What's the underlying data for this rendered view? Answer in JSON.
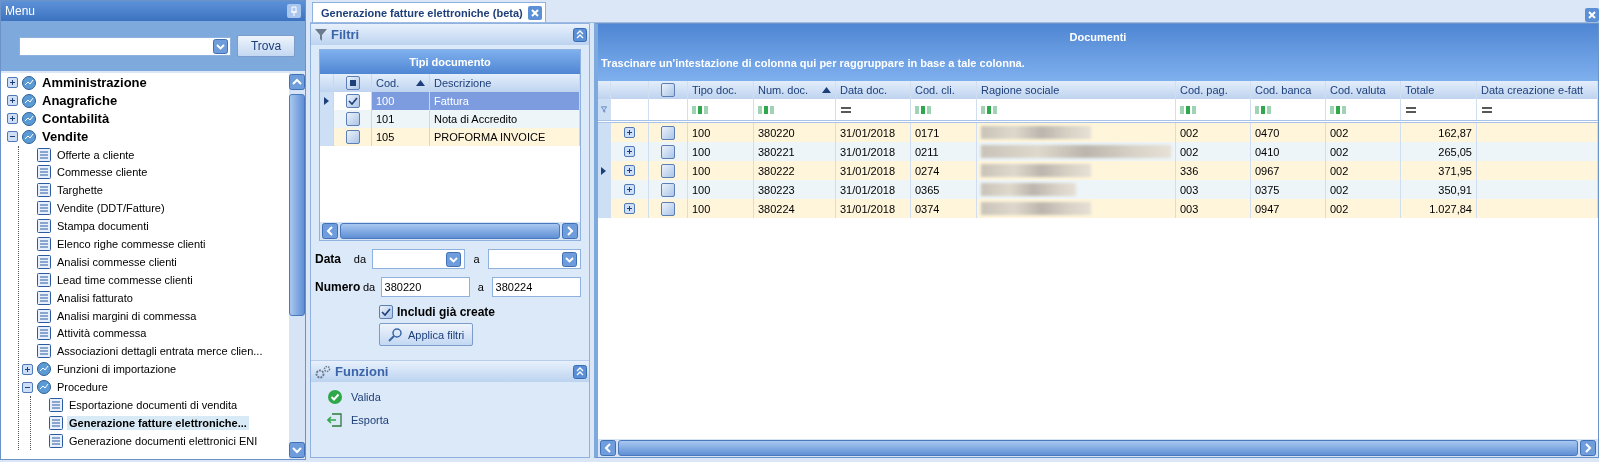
{
  "menu": {
    "title": "Menu",
    "search_button": "Trova",
    "tree": [
      {
        "label": "Amministrazione",
        "expanded": false,
        "selected": false
      },
      {
        "label": "Anagrafiche",
        "expanded": false,
        "selected": false
      },
      {
        "label": "Contabilità",
        "expanded": false,
        "selected": false
      },
      {
        "label": "Vendite",
        "expanded": true,
        "selected": false,
        "children": [
          {
            "label": "Offerte a cliente",
            "selected": false
          },
          {
            "label": "Commesse cliente",
            "selected": false
          },
          {
            "label": "Targhette",
            "selected": false
          },
          {
            "label": "Vendite (DDT/Fatture)",
            "selected": false
          },
          {
            "label": "Stampa documenti",
            "selected": false
          },
          {
            "label": "Elenco righe commesse clienti",
            "selected": false
          },
          {
            "label": "Analisi commesse clienti",
            "selected": false
          },
          {
            "label": "Lead time commesse clienti",
            "selected": false
          },
          {
            "label": "Analisi fatturato",
            "selected": false
          },
          {
            "label": "Analisi margini di commessa",
            "selected": false
          },
          {
            "label": "Attività commessa",
            "selected": false
          },
          {
            "label": "Associazioni dettagli entrata merce clien...",
            "selected": false
          },
          {
            "label": "Funzioni di importazione",
            "expanded": false,
            "selected": false
          },
          {
            "label": "Procedure",
            "expanded": true,
            "selected": false,
            "children": [
              {
                "label": "Esportazione documenti di vendita",
                "selected": false
              },
              {
                "label": "Generazione fatture elettroniche...",
                "selected": true
              },
              {
                "label": "Generazione documenti elettronici ENI",
                "selected": false
              }
            ]
          }
        ]
      }
    ]
  },
  "tabs": [
    {
      "label": "Generazione fatture elettroniche (beta)",
      "selected": true
    }
  ],
  "filters": {
    "title": "Filtri",
    "types_grid": {
      "title": "Tipi documento",
      "select_all_partial": true,
      "columns": [
        {
          "label": "Cod.",
          "sorted": true
        },
        {
          "label": "Descrizione",
          "sorted": false
        }
      ],
      "rows": [
        {
          "cod": "100",
          "descrizione": "Fattura",
          "checked": true,
          "selected": true
        },
        {
          "cod": "101",
          "descrizione": "Nota di Accredito",
          "checked": false,
          "selected": false
        },
        {
          "cod": "105",
          "descrizione": "PROFORMA INVOICE",
          "checked": false,
          "selected": false
        }
      ]
    },
    "date": {
      "label": "Data",
      "from_label": "da",
      "to_label": "a"
    },
    "number": {
      "label": "Numero",
      "from_label": "da",
      "from_value": "380220",
      "to_label": "a",
      "to_value": "380224"
    },
    "include_created": {
      "label": "Includi già create",
      "checked": true
    },
    "apply_button": "Applica filtri"
  },
  "functions": {
    "title": "Funzioni",
    "actions": [
      {
        "label": "Valida",
        "kind": "validate"
      },
      {
        "label": "Esporta",
        "kind": "export"
      }
    ]
  },
  "documents": {
    "title": "Documenti",
    "group_hint": "Trascinare un'intestazione di colonna qui per raggruppare in base a tale colonna.",
    "select_all_checked": false,
    "columns": [
      {
        "label": "Tipo doc.",
        "kind": "text",
        "sorted": false
      },
      {
        "label": "Num. doc.",
        "kind": "text",
        "sorted": true
      },
      {
        "label": "Data doc.",
        "kind": "date",
        "sorted": false
      },
      {
        "label": "Cod. cli.",
        "kind": "text",
        "sorted": false
      },
      {
        "label": "Ragione sociale",
        "kind": "text",
        "sorted": false
      },
      {
        "label": "Cod. pag.",
        "kind": "text",
        "sorted": false
      },
      {
        "label": "Cod. banca",
        "kind": "text",
        "sorted": false
      },
      {
        "label": "Cod. valuta",
        "kind": "text",
        "sorted": false
      },
      {
        "label": "Totale",
        "kind": "amount",
        "sorted": false
      },
      {
        "label": "Data creazione e-fatt",
        "kind": "date",
        "sorted": false
      }
    ],
    "rows": [
      {
        "cells": [
          "100",
          "380220",
          "31/01/2018",
          "0171",
          {
            "kind": "redacted"
          },
          "002",
          "0470",
          "002",
          "162,87"
        ],
        "checked": false,
        "selected": false
      },
      {
        "cells": [
          "100",
          "380221",
          "31/01/2018",
          "0211",
          {
            "kind": "redacted"
          },
          "002",
          "0410",
          "002",
          "265,05"
        ],
        "checked": false,
        "selected": false
      },
      {
        "cells": [
          "100",
          "380222",
          "31/01/2018",
          "0274",
          {
            "kind": "redacted"
          },
          "336",
          "0967",
          "002",
          "371,95"
        ],
        "checked": false,
        "selected": true
      },
      {
        "cells": [
          "100",
          "380223",
          "31/01/2018",
          "0365",
          {
            "kind": "redacted"
          },
          "003",
          "0375",
          "002",
          "350,91"
        ],
        "checked": false,
        "selected": false
      },
      {
        "cells": [
          "100",
          "380224",
          "31/01/2018",
          "0374",
          {
            "kind": "redacted"
          },
          "003",
          "0947",
          "002",
          "1.027,84"
        ],
        "checked": false,
        "selected": false
      }
    ]
  }
}
